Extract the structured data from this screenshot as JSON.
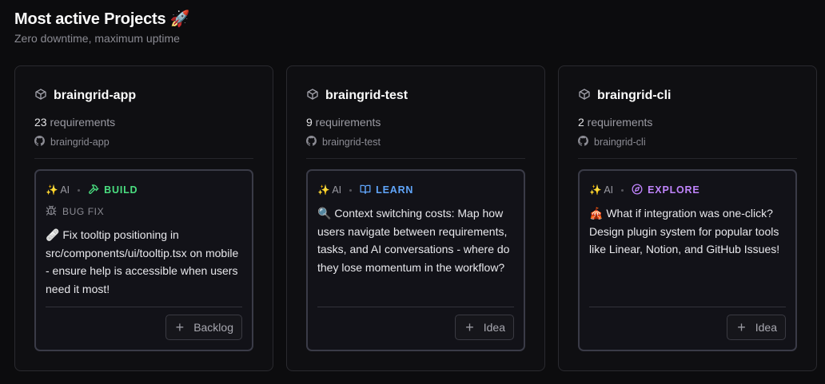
{
  "header": {
    "title": "Most active Projects 🚀",
    "subtitle": "Zero downtime, maximum uptime"
  },
  "cards": [
    {
      "name": "braingrid-app",
      "req_count": "23",
      "req_label": " requirements",
      "repo": "braingrid-app",
      "ai_label": "✨ AI",
      "mode": "BUILD",
      "mode_color": "#4ade80",
      "mode_icon": "hammer-icon",
      "category": "BUG FIX",
      "category_icon": "bug-icon",
      "description": "🩹 Fix tooltip positioning in src/components/ui/tooltip.tsx on mobile - ensure help is accessible when users need it most!",
      "action": "Backlog"
    },
    {
      "name": "braingrid-test",
      "req_count": "9",
      "req_label": " requirements",
      "repo": "braingrid-test",
      "ai_label": "✨ AI",
      "mode": "LEARN",
      "mode_color": "#60a5fa",
      "mode_icon": "book-open-icon",
      "description": "🔍 Context switching costs: Map how users navigate between requirements, tasks, and AI conversations - where do they lose momentum in the workflow?",
      "action": "Idea"
    },
    {
      "name": "braingrid-cli",
      "req_count": "2",
      "req_label": " requirements",
      "repo": "braingrid-cli",
      "ai_label": "✨ AI",
      "mode": "EXPLORE",
      "mode_color": "#c084fc",
      "mode_icon": "compass-icon",
      "description": "🎪 What if integration was one-click? Design plugin system for popular tools like Linear, Notion, and GitHub Issues!",
      "action": "Idea"
    }
  ]
}
